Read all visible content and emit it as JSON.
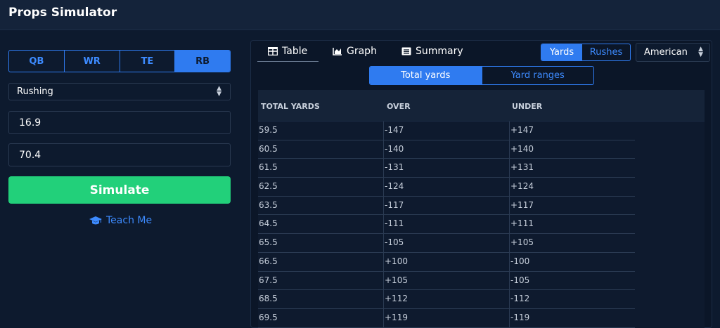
{
  "app": {
    "title": "Props Simulator"
  },
  "positions": [
    {
      "label": "QB",
      "active": false
    },
    {
      "label": "WR",
      "active": false
    },
    {
      "label": "TE",
      "active": false
    },
    {
      "label": "RB",
      "active": true
    }
  ],
  "stat_select": {
    "value": "Rushing"
  },
  "inputs": {
    "first": "16.9",
    "second": "70.4"
  },
  "simulate": {
    "label": "Simulate"
  },
  "teach_me": {
    "label": "Teach Me"
  },
  "tabs": {
    "table": "Table",
    "graph": "Graph",
    "summary": "Summary"
  },
  "metric_toggle": {
    "yards": "Yards",
    "rushes": "Rushes"
  },
  "odds_select": {
    "value": "American"
  },
  "view_toggle": {
    "total": "Total yards",
    "ranges": "Yard ranges"
  },
  "table": {
    "headers": {
      "total": "TOTAL YARDS",
      "over": "OVER",
      "under": "UNDER"
    },
    "rows": [
      {
        "yards": "59.5",
        "over": "-147",
        "under": "+147"
      },
      {
        "yards": "60.5",
        "over": "-140",
        "under": "+140"
      },
      {
        "yards": "61.5",
        "over": "-131",
        "under": "+131"
      },
      {
        "yards": "62.5",
        "over": "-124",
        "under": "+124"
      },
      {
        "yards": "63.5",
        "over": "-117",
        "under": "+117"
      },
      {
        "yards": "64.5",
        "over": "-111",
        "under": "+111"
      },
      {
        "yards": "65.5",
        "over": "-105",
        "under": "+105"
      },
      {
        "yards": "66.5",
        "over": "+100",
        "under": "-100"
      },
      {
        "yards": "67.5",
        "over": "+105",
        "under": "-105"
      },
      {
        "yards": "68.5",
        "over": "+112",
        "under": "-112"
      },
      {
        "yards": "69.5",
        "over": "+119",
        "under": "-119"
      }
    ]
  },
  "colors": {
    "accent": "#2f7bf0",
    "simulate": "#22d07a",
    "background": "#0d1a2e"
  }
}
